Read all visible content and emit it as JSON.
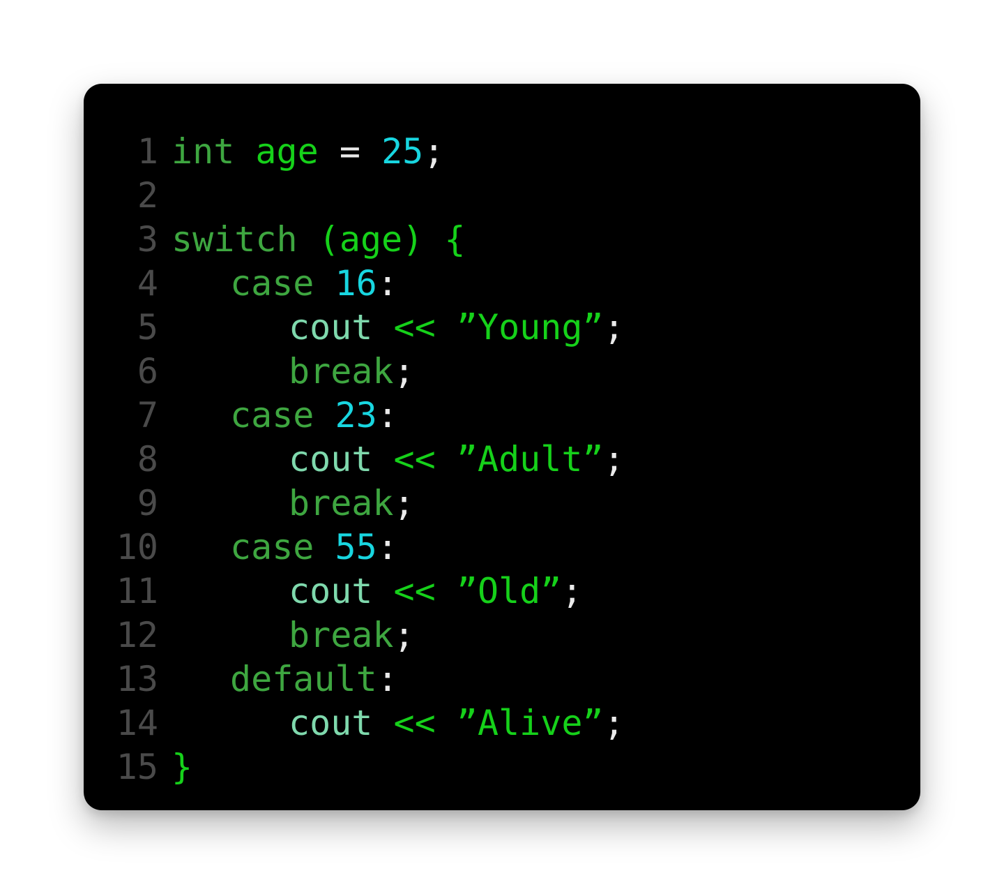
{
  "editor": {
    "lines": [
      {
        "n": "1",
        "tokens": [
          [
            "kw",
            "int"
          ],
          [
            "sp",
            " "
          ],
          [
            "ident",
            "age"
          ],
          [
            "sp",
            " "
          ],
          [
            "punct",
            "="
          ],
          [
            "sp",
            " "
          ],
          [
            "num",
            "25"
          ],
          [
            "punct",
            ";"
          ]
        ]
      },
      {
        "n": "2",
        "tokens": []
      },
      {
        "n": "3",
        "tokens": [
          [
            "kw",
            "switch"
          ],
          [
            "sp",
            " "
          ],
          [
            "ident",
            "(age)"
          ],
          [
            "sp",
            " "
          ],
          [
            "ident",
            "{"
          ]
        ]
      },
      {
        "n": "4",
        "indent": 1,
        "tokens": [
          [
            "kw",
            "case"
          ],
          [
            "sp",
            " "
          ],
          [
            "num",
            "16"
          ],
          [
            "punct",
            ":"
          ]
        ]
      },
      {
        "n": "5",
        "indent": 2,
        "tokens": [
          [
            "func",
            "cout"
          ],
          [
            "sp",
            " "
          ],
          [
            "stream",
            "<<"
          ],
          [
            "sp",
            " "
          ],
          [
            "string",
            "”Young”"
          ],
          [
            "punct",
            ";"
          ]
        ]
      },
      {
        "n": "6",
        "indent": 2,
        "tokens": [
          [
            "kw",
            "break"
          ],
          [
            "punct",
            ";"
          ]
        ]
      },
      {
        "n": "7",
        "indent": 1,
        "tokens": [
          [
            "kw",
            "case"
          ],
          [
            "sp",
            " "
          ],
          [
            "num",
            "23"
          ],
          [
            "punct",
            ":"
          ]
        ]
      },
      {
        "n": "8",
        "indent": 2,
        "tokens": [
          [
            "func",
            "cout"
          ],
          [
            "sp",
            " "
          ],
          [
            "stream",
            "<<"
          ],
          [
            "sp",
            " "
          ],
          [
            "string",
            "”Adult”"
          ],
          [
            "punct",
            ";"
          ]
        ]
      },
      {
        "n": "9",
        "indent": 2,
        "tokens": [
          [
            "kw",
            "break"
          ],
          [
            "punct",
            ";"
          ]
        ]
      },
      {
        "n": "10",
        "indent": 1,
        "tokens": [
          [
            "kw",
            "case"
          ],
          [
            "sp",
            " "
          ],
          [
            "num",
            "55"
          ],
          [
            "punct",
            ":"
          ]
        ]
      },
      {
        "n": "11",
        "indent": 2,
        "tokens": [
          [
            "func",
            "cout"
          ],
          [
            "sp",
            " "
          ],
          [
            "stream",
            "<<"
          ],
          [
            "sp",
            " "
          ],
          [
            "string",
            "”Old”"
          ],
          [
            "punct",
            ";"
          ]
        ]
      },
      {
        "n": "12",
        "indent": 2,
        "tokens": [
          [
            "kw",
            "break"
          ],
          [
            "punct",
            ";"
          ]
        ]
      },
      {
        "n": "13",
        "indent": 1,
        "tokens": [
          [
            "kw",
            "default"
          ],
          [
            "punct",
            ":"
          ]
        ]
      },
      {
        "n": "14",
        "indent": 2,
        "tokens": [
          [
            "func",
            "cout"
          ],
          [
            "sp",
            " "
          ],
          [
            "stream",
            "<<"
          ],
          [
            "sp",
            " "
          ],
          [
            "string",
            "”Alive”"
          ],
          [
            "punct",
            ";"
          ]
        ]
      },
      {
        "n": "15",
        "tokens": [
          [
            "ident",
            "}"
          ]
        ]
      }
    ]
  },
  "colors": {
    "background": "#000000",
    "line_number": "#4a4a4a",
    "keyword": "#3ea640",
    "identifier": "#16d11a",
    "number": "#18d6e0",
    "punctuation": "#eaeaea",
    "function": "#7fd9ad",
    "string": "#16d11a"
  }
}
